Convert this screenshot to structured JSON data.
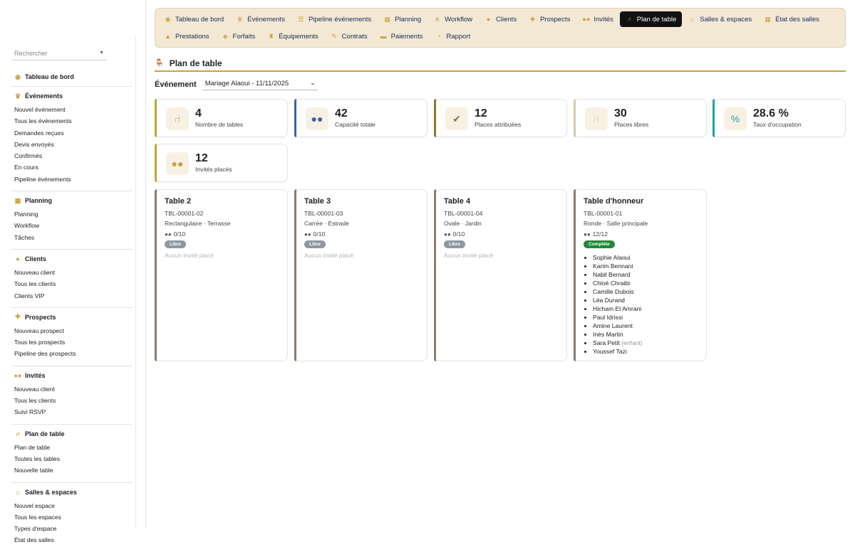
{
  "sidebar": {
    "search_placeholder": "Rechercher",
    "sections": [
      {
        "title": "Tableau de bord",
        "icon": "dashboard-icon",
        "items": []
      },
      {
        "title": "Événements",
        "icon": "events-icon",
        "items": [
          "Nouvel événement",
          "Tous les événements",
          "Demandes reçues",
          "Devis envoyés",
          "Confirmés",
          "En cours",
          "Pipeline événements"
        ]
      },
      {
        "title": "Planning",
        "icon": "calendar-icon",
        "items": [
          "Planning",
          "Workflow",
          "Tâches"
        ]
      },
      {
        "title": "Clients",
        "icon": "user-icon",
        "items": [
          "Nouveau client",
          "Tous les clients",
          "Clients VIP"
        ]
      },
      {
        "title": "Prospects",
        "icon": "user-plus-icon",
        "items": [
          "Nouveau prospect",
          "Tous les prospects",
          "Pipeline des prospects"
        ]
      },
      {
        "title": "Invités",
        "icon": "guests-icon",
        "items": [
          "Nouveau client",
          "Tous les clients",
          "Suivi RSVP"
        ]
      },
      {
        "title": "Plan de table",
        "icon": "chair-icon",
        "items": [
          "Plan de table",
          "Toutes les tables",
          "Nouvelle table"
        ]
      },
      {
        "title": "Salles & espaces",
        "icon": "venue-icon",
        "items": [
          "Nouvel espace",
          "Tous les espaces",
          "Types d'espace",
          "État des salles"
        ]
      }
    ]
  },
  "topnav": {
    "row1": [
      {
        "label": "Tableau de bord",
        "icon": "dashboard-icon",
        "active": false
      },
      {
        "label": "Événements",
        "icon": "events-icon",
        "active": false
      },
      {
        "label": "Pipeline événements",
        "icon": "pipeline-icon",
        "active": false
      },
      {
        "label": "Planning",
        "icon": "calendar-icon",
        "active": false
      },
      {
        "label": "Workflow",
        "icon": "workflow-icon",
        "active": false
      },
      {
        "label": "Clients",
        "icon": "user-icon",
        "active": false
      },
      {
        "label": "Prospects",
        "icon": "user-plus-icon",
        "active": false
      },
      {
        "label": "Invités",
        "icon": "guests-icon",
        "active": false
      },
      {
        "label": "Plan de table",
        "icon": "chair-icon",
        "active": true
      },
      {
        "label": "Salles & espaces",
        "icon": "venue-icon",
        "active": false
      },
      {
        "label": "État des salles",
        "icon": "grid-icon",
        "active": false
      }
    ],
    "row2": [
      {
        "label": "Prestations",
        "icon": "service-icon",
        "active": false
      },
      {
        "label": "Forfaits",
        "icon": "package-icon",
        "active": false
      },
      {
        "label": "Équipements",
        "icon": "equipment-icon",
        "active": false
      },
      {
        "label": "Contrats",
        "icon": "contract-icon",
        "active": false
      },
      {
        "label": "Paiements",
        "icon": "payment-icon",
        "active": false
      },
      {
        "label": "Rapport",
        "icon": "report-icon",
        "active": false
      }
    ]
  },
  "page": {
    "title": "Plan de table",
    "event_label": "Événement",
    "event_value": "Mariage Alaoui - 11/11/2025"
  },
  "stats": [
    {
      "value": "4",
      "label": "Nombre de tables",
      "icon": "chair-icon",
      "color": "#c9a23a"
    },
    {
      "value": "42",
      "label": "Capacité totale",
      "icon": "users-icon",
      "color": "#3b63a8"
    },
    {
      "value": "12",
      "label": "Places attribuées",
      "icon": "user-check-icon",
      "color": "#8a7a2a"
    },
    {
      "value": "30",
      "label": "Places libres",
      "icon": "chair-icon",
      "color": "#d8c8a8"
    },
    {
      "value": "28.6 %",
      "label": "Taux d'occupation",
      "icon": "percent-icon",
      "color": "#1aa6a0"
    },
    {
      "value": "12",
      "label": "Invités placés",
      "icon": "guests-icon",
      "color": "#c9a23a"
    }
  ],
  "tables": [
    {
      "name": "Table 2",
      "code": "TBL-00001-02",
      "meta": "Rectangulaire · Terrasse",
      "capacity": "0/10",
      "badge": "Libre",
      "badge_type": "free",
      "empty_text": "Aucun invité placé",
      "guests": []
    },
    {
      "name": "Table 3",
      "code": "TBL-00001-03",
      "meta": "Carrée · Estrade",
      "capacity": "0/10",
      "badge": "Libre",
      "badge_type": "free",
      "empty_text": "Aucun invité placé",
      "guests": []
    },
    {
      "name": "Table 4",
      "code": "TBL-00001-04",
      "meta": "Ovale · Jardin",
      "capacity": "0/10",
      "badge": "Libre",
      "badge_type": "free",
      "empty_text": "Aucun invité placé",
      "guests": []
    },
    {
      "name": "Table d'honneur",
      "code": "TBL-00001-01",
      "meta": "Ronde · Salle principale",
      "capacity": "12/12",
      "badge": "Complète",
      "badge_type": "full",
      "empty_text": "",
      "guests": [
        {
          "name": "Sophie Alaoui",
          "tag": ""
        },
        {
          "name": "Karim Bennani",
          "tag": ""
        },
        {
          "name": "Nabil Bernard",
          "tag": ""
        },
        {
          "name": "Chloé Chraibi",
          "tag": ""
        },
        {
          "name": "Camille Dubois",
          "tag": ""
        },
        {
          "name": "Léa Durand",
          "tag": ""
        },
        {
          "name": "Hicham El Amrani",
          "tag": ""
        },
        {
          "name": "Paul Idrissi",
          "tag": ""
        },
        {
          "name": "Amine Laurent",
          "tag": ""
        },
        {
          "name": "Inès Martin",
          "tag": ""
        },
        {
          "name": "Sara Petit",
          "tag": "(enfant)"
        },
        {
          "name": "Youssef Tazi",
          "tag": ""
        }
      ]
    }
  ]
}
